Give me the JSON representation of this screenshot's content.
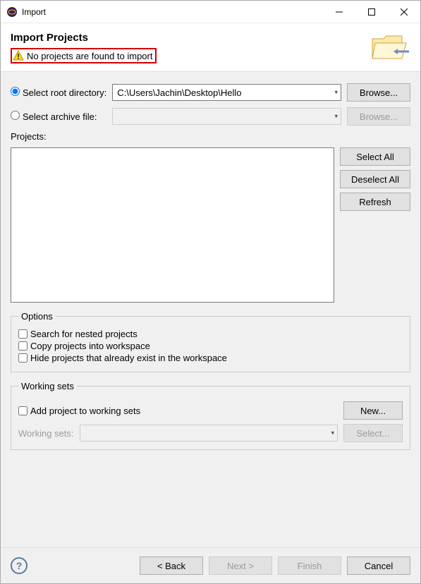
{
  "window": {
    "title": "Import"
  },
  "banner": {
    "heading": "Import Projects",
    "warning": "No projects are found to import"
  },
  "source": {
    "rootLabel": "Select root directory:",
    "rootValue": "C:\\Users\\Jachin\\Desktop\\Hello",
    "archiveLabel": "Select archive file:",
    "archiveValue": "",
    "browse": "Browse..."
  },
  "projects": {
    "label": "Projects:",
    "selectAll": "Select All",
    "deselectAll": "Deselect All",
    "refresh": "Refresh"
  },
  "options": {
    "legend": "Options",
    "nested": "Search for nested projects",
    "copy": "Copy projects into workspace",
    "hide": "Hide projects that already exist in the workspace"
  },
  "workingSets": {
    "legend": "Working sets",
    "add": "Add project to working sets",
    "new": "New...",
    "label": "Working sets:",
    "select": "Select..."
  },
  "footer": {
    "back": "< Back",
    "next": "Next >",
    "finish": "Finish",
    "cancel": "Cancel"
  }
}
